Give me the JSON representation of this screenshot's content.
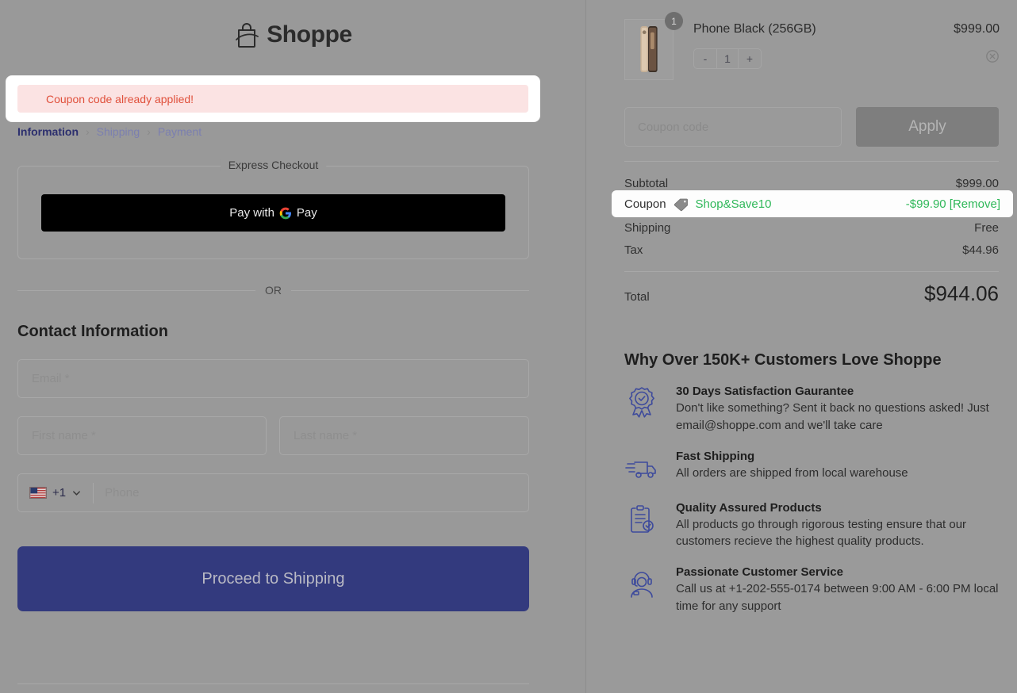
{
  "brand": {
    "name": "Shoppe",
    "logo_icon": "shopping-bag-icon"
  },
  "alert": {
    "message": "Coupon code already applied!",
    "type": "error",
    "color": "#e0503b",
    "background": "#fbe3e3"
  },
  "breadcrumb": {
    "items": [
      {
        "label": "Information",
        "active": true
      },
      {
        "label": "Shipping",
        "active": false
      },
      {
        "label": "Payment",
        "active": false
      }
    ],
    "separator": "›",
    "active_color": "#2c2f6e",
    "inactive_color": "#7b7fb0"
  },
  "express_checkout": {
    "legend": "Express Checkout",
    "gpay_prefix": "Pay with",
    "gpay_suffix": "Pay",
    "gpay_icon": "google-g-icon"
  },
  "divider": {
    "or_label": "OR"
  },
  "contact": {
    "title": "Contact Information",
    "email_placeholder": "Email *",
    "first_name_placeholder": "First name *",
    "last_name_placeholder": "Last name *",
    "phone_placeholder": "Phone",
    "dial_code": "+1",
    "flag_icon": "us-flag-icon",
    "chevron_icon": "chevron-down-icon"
  },
  "primary_action": {
    "label": "Proceed to Shipping",
    "color": "#333a7e"
  },
  "cart": {
    "item": {
      "name": "Phone Black (256GB)",
      "price": "$999.00",
      "quantity_badge": "1",
      "quantity": "1",
      "decrement_label": "-",
      "increment_label": "+",
      "remove_icon": "remove-circle-icon",
      "thumbnail_icon": "phone-product-image"
    }
  },
  "coupon_form": {
    "placeholder": "Coupon code",
    "value": "",
    "apply_label": "Apply",
    "apply_disabled": true
  },
  "summary": {
    "subtotal_label": "Subtotal",
    "subtotal_value": "$999.00",
    "coupon_label": "Coupon",
    "coupon_icon": "price-tag-icon",
    "coupon_code": "Shop&Save10",
    "coupon_value": "-$99.90 [Remove]",
    "coupon_color": "#2fb859",
    "shipping_label": "Shipping",
    "shipping_value": "Free",
    "tax_label": "Tax",
    "tax_value": "$44.96",
    "total_label": "Total",
    "total_value": "$944.06"
  },
  "benefits": {
    "title": "Why Over 150K+ Customers Love Shoppe",
    "items": [
      {
        "icon": "satisfaction-badge-icon",
        "heading": "30 Days Satisfaction Gaurantee",
        "body": "Don't like something? Sent it back no questions asked! Just email@shoppe.com and we'll take care"
      },
      {
        "icon": "delivery-truck-icon",
        "heading": "Fast Shipping",
        "body": "All orders are shipped from local warehouse"
      },
      {
        "icon": "clipboard-check-icon",
        "heading": "Quality Assured Products",
        "body": "All products go through rigorous testing ensure that our customers recieve the highest quality products."
      },
      {
        "icon": "headset-agent-icon",
        "heading": "Passionate Customer Service",
        "body": "Call us at +1-202-555-0174 between 9:00 AM - 6:00 PM local time for any support"
      }
    ],
    "icon_color": "#3d4a9c"
  }
}
